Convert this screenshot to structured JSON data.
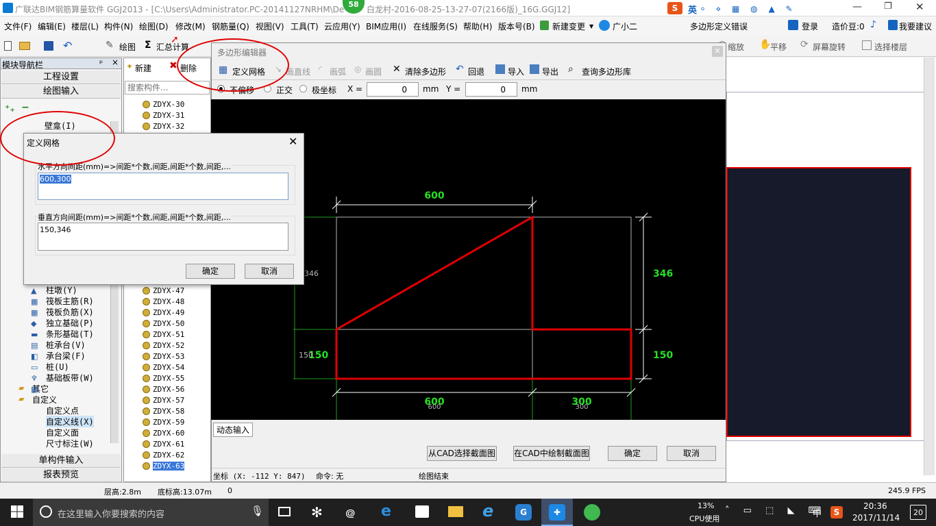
{
  "titlebar": {
    "title": "广联达BIM钢筋算量软件 GGJ2013 - [C:\\Users\\Administrator.PC-20141127NRHM\\De",
    "title_right": "白龙村-2016-08-25-13-27-07(2166版)_16G.GGJ12]",
    "badge": "58",
    "ime_label": "英"
  },
  "menubar": {
    "items": [
      "文件(F)",
      "编辑(E)",
      "楼层(L)",
      "构件(N)",
      "绘图(D)",
      "修改(M)",
      "钢筋量(Q)",
      "视图(V)",
      "工具(T)",
      "云应用(Y)",
      "BIM应用(I)",
      "在线服务(S)",
      "帮助(H)",
      "版本号(B)",
      "新建变更",
      "广小二"
    ],
    "notice": "多边形定义错误",
    "login": "登录",
    "coin": "造价豆:0",
    "suggest": "我要建议"
  },
  "toolbar": {
    "draw": "绘图",
    "sum": "汇总计算",
    "zoom": "缩放",
    "pan": "平移",
    "rotate": "屏幕旋转",
    "select_floor": "选择楼层"
  },
  "nav": {
    "title": "模块导航栏",
    "pin": "ᵖ",
    "close": "×",
    "project_settings": "工程设置",
    "draw_input": "绘图输入",
    "single_input": "单构件输入",
    "report_preview": "报表预览",
    "tree": [
      "壁龛(I)",
      "柱墩(Y)",
      "筏板主筋(R)",
      "筏板负筋(X)",
      "独立基础(P)",
      "条形基础(T)",
      "桩承台(V)",
      "承台梁(F)",
      "桩(U)",
      "基础板带(W)",
      "其它",
      "自定义",
      "自定义点",
      "自定义线(X)",
      "自定义面",
      "尺寸标注(W)"
    ]
  },
  "list": {
    "new": "新建",
    "delete": "删除",
    "search_placeholder": "搜索构件...",
    "top_items": [
      "ZDYX-30",
      "ZDYX-31",
      "ZDYX-32"
    ],
    "items": [
      "ZDYX-47",
      "ZDYX-48",
      "ZDYX-49",
      "ZDYX-50",
      "ZDYX-51",
      "ZDYX-52",
      "ZDYX-53",
      "ZDYX-54",
      "ZDYX-55",
      "ZDYX-56",
      "ZDYX-57",
      "ZDYX-58",
      "ZDYX-59",
      "ZDYX-60",
      "ZDYX-61",
      "ZDYX-62",
      "ZDYX-63"
    ]
  },
  "editor": {
    "title": "多边形编辑器",
    "define_grid": "定义网格",
    "line": "画直线",
    "arc": "画弧",
    "circle": "画圆",
    "clear": "清除多边形",
    "undo": "回退",
    "import": "导入",
    "export": "导出",
    "query": "查询多边形库",
    "mode_none": "不偏移",
    "mode_ortho": "正交",
    "mode_polar": "极坐标",
    "x_label": "X =",
    "x_value": "0",
    "y_label": "Y =",
    "y_value": "0",
    "unit": "mm",
    "dynamic_input": "动态输入",
    "from_cad": "从CAD选择截面图",
    "draw_cad": "在CAD中绘制截面图",
    "ok": "确定",
    "cancel": "取消",
    "coord": "坐标 (X: -112 Y: 847)",
    "command": "命令: 无",
    "status": "绘图结束"
  },
  "canvas": {
    "dim_top": "600",
    "dim_right_top": "346",
    "dim_right_bottom": "150",
    "dim_left_bottom": "150",
    "dim_left_top": "346",
    "dim_bottom_left": "600",
    "dim_bottom_right": "300",
    "dim_left_bottom_small": "150",
    "dim_bottom_left_small": "600",
    "dim_bottom_right_small": "300"
  },
  "dialog": {
    "title": "定义网格",
    "h_label": "水平方向间距(mm)=>间距*个数,间距,间距*个数,间距,...",
    "h_value": "600,300",
    "v_label": "垂直方向间距(mm)=>间距*个数,间距,间距*个数,间距,...",
    "v_value": "150,346",
    "ok": "确定",
    "cancel": "取消"
  },
  "statusbar": {
    "floor_height": "层高:2.8m",
    "base_height": "底标高:13.07m",
    "zero": "0",
    "fps": "245.9 FPS"
  },
  "taskbar": {
    "search_placeholder": "在这里输入你要搜索的内容",
    "cpu_pct": "13%",
    "cpu_label": "CPU使用",
    "ime": "中",
    "time": "20:36",
    "date": "2017/11/14",
    "notif": "20"
  },
  "colors": {
    "accent": "#0a7bd4",
    "red": "#e00000",
    "green_dim": "#25e025",
    "taskbar": "#1f1f1f"
  }
}
